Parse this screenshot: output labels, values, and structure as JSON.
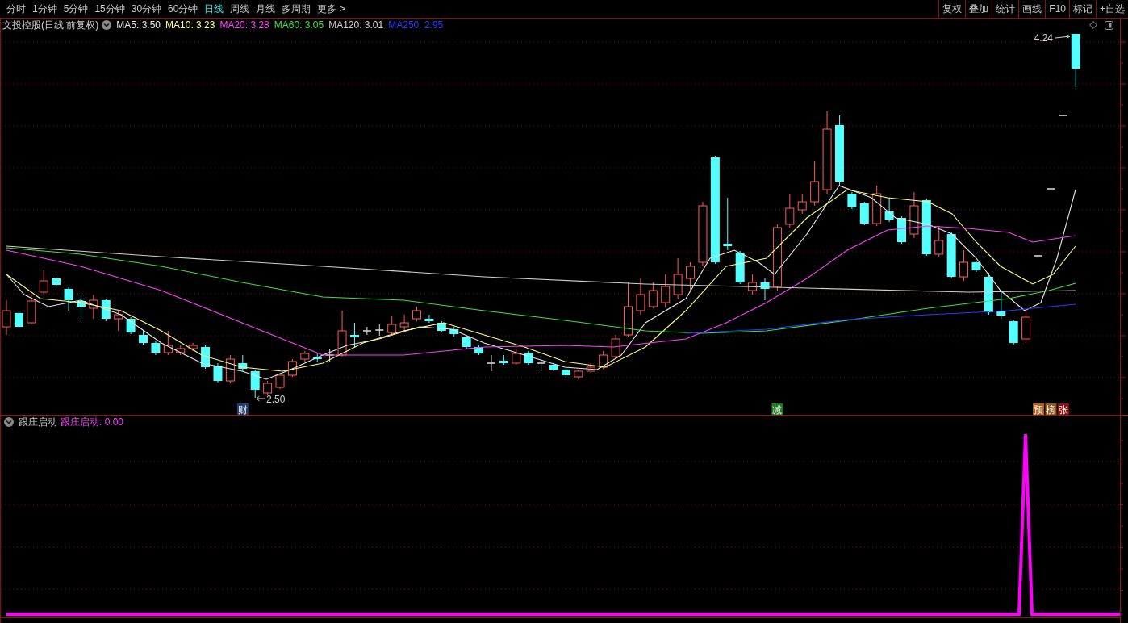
{
  "toolbar": {
    "periods": [
      {
        "label": "分时",
        "selected": false
      },
      {
        "label": "1分钟",
        "selected": false
      },
      {
        "label": "5分钟",
        "selected": false
      },
      {
        "label": "15分钟",
        "selected": false
      },
      {
        "label": "30分钟",
        "selected": false
      },
      {
        "label": "60分钟",
        "selected": false
      },
      {
        "label": "日线",
        "selected": true
      },
      {
        "label": "周线",
        "selected": false
      },
      {
        "label": "月线",
        "selected": false
      },
      {
        "label": "多周期",
        "selected": false
      }
    ],
    "more_menu": "更多 >",
    "actions": [
      "复权",
      "叠加",
      "统计",
      "画线",
      "F10",
      "标记",
      "+自选"
    ]
  },
  "main_chart": {
    "title": "文投控股(日线.前复权)",
    "indicators": [
      {
        "label": "MA5: 3.50",
        "color": "#e8e8e8"
      },
      {
        "label": "MA10: 3.23",
        "color": "#ffff80"
      },
      {
        "label": "MA20: 3.28",
        "color": "#ff40ff"
      },
      {
        "label": "MA60: 3.05",
        "color": "#40e040"
      },
      {
        "label": "MA120: 3.01",
        "color": "#d0d0c8"
      },
      {
        "label": "MA250: 2.95",
        "color": "#2838ff"
      }
    ],
    "high_label": "4.24",
    "low_label": "2.50",
    "signals": [
      {
        "text": "财",
        "color": "#1f3f6f"
      },
      {
        "text": "减",
        "color": "#1b7a1b"
      },
      {
        "text": "预",
        "color": "#b0601c"
      },
      {
        "text": "榜",
        "color": "#8c5a1a"
      },
      {
        "text": "张",
        "color": "#8a1010"
      }
    ]
  },
  "sub_chart": {
    "title": "跟庄启动",
    "reading": "跟庄启动: 0.00"
  }
}
